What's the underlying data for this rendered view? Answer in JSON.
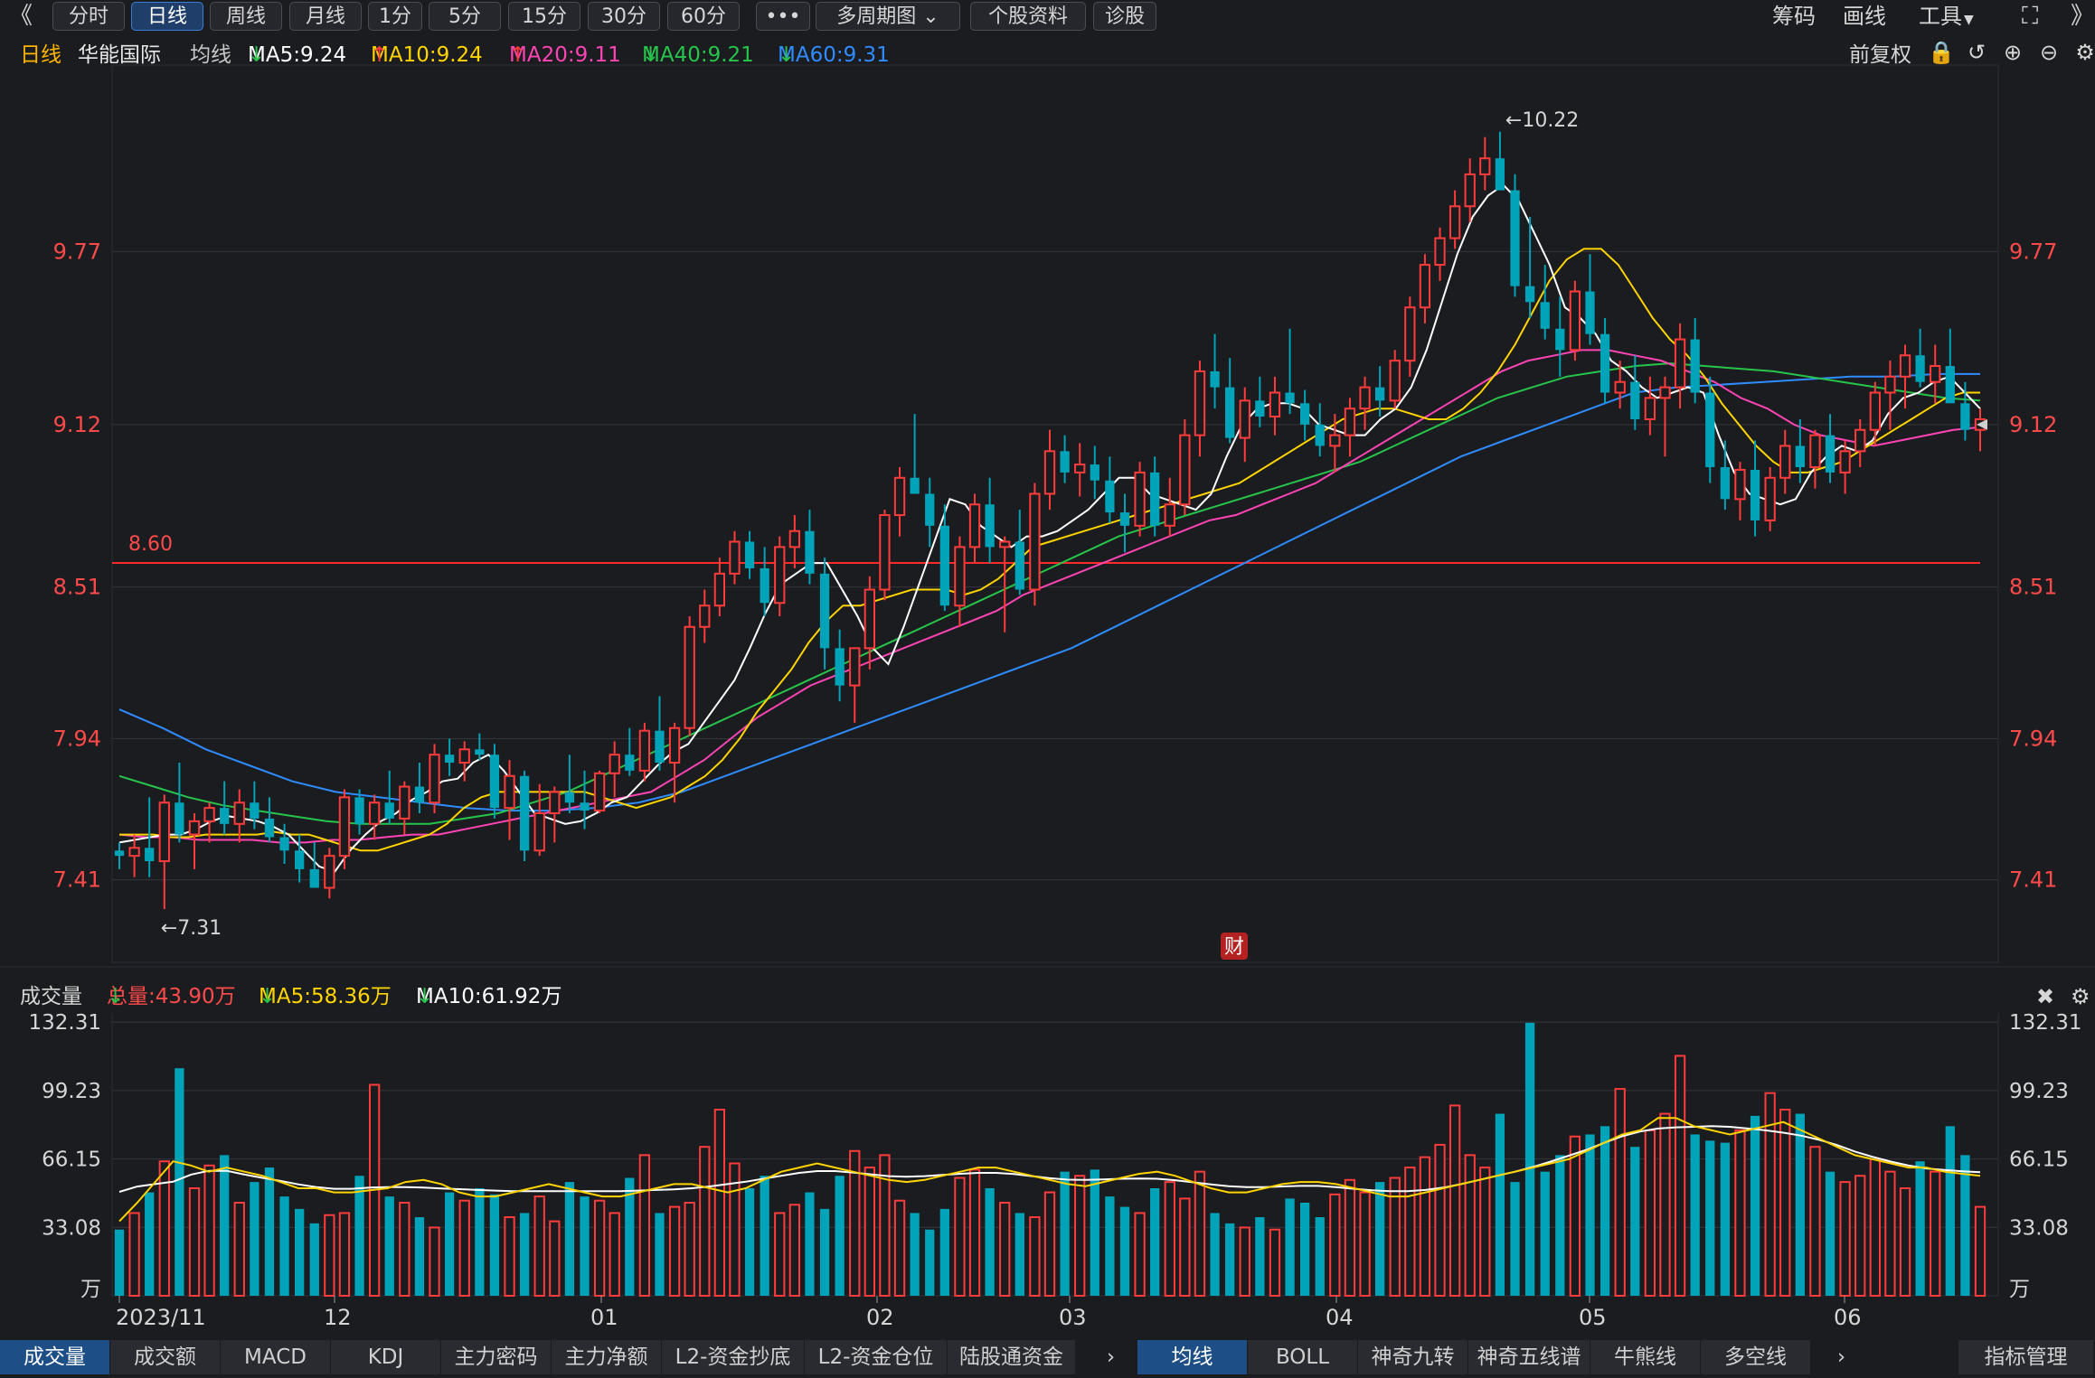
{
  "toolbar": {
    "back_icon": "double-chevron-left-icon",
    "tabs": [
      {
        "label": "分时",
        "active": false
      },
      {
        "label": "日线",
        "active": true
      },
      {
        "label": "周线",
        "active": false
      },
      {
        "label": "月线",
        "active": false
      },
      {
        "label": "1分",
        "active": false
      },
      {
        "label": "5分",
        "active": false
      },
      {
        "label": "15分",
        "active": false
      },
      {
        "label": "30分",
        "active": false
      },
      {
        "label": "60分",
        "active": false
      },
      {
        "label": "•••",
        "active": false
      },
      {
        "label": "多周期图",
        "active": false
      },
      {
        "label": "个股资料",
        "active": false
      },
      {
        "label": "诊股",
        "active": false
      }
    ],
    "right": [
      "筹码",
      "画线",
      "工具"
    ]
  },
  "legend": {
    "period": "日线",
    "stock": "华能国际",
    "ma_label": "均线",
    "mas": [
      {
        "text": "MA5:9.24",
        "arrow": "↓",
        "color": "#ffffff",
        "arrow_color": "#27c44b"
      },
      {
        "text": "MA10:9.24",
        "arrow": "↑",
        "color": "#ffd400",
        "arrow_color": "#ff3b3b"
      },
      {
        "text": "MA20:9.11",
        "arrow": "↑",
        "color": "#ff44b4",
        "arrow_color": "#ff3b3b"
      },
      {
        "text": "MA40:9.21",
        "arrow": "↓",
        "color": "#27c44b",
        "arrow_color": "#27c44b"
      },
      {
        "text": "MA60:9.31",
        "arrow": "↓",
        "color": "#2f8cff",
        "arrow_color": "#27c44b"
      }
    ],
    "fq": "前复权"
  },
  "volume_legend": {
    "title": "成交量",
    "total": "总量:43.90万",
    "ma5": "MA5:58.36万",
    "ma10": "MA10:61.92万"
  },
  "bottom_tabs_left": [
    "成交量",
    "成交额",
    "MACD",
    "KDJ",
    "主力密码",
    "主力净额",
    "L2-资金抄底",
    "L2-资金仓位",
    "陆股通资金"
  ],
  "bottom_tabs_right": [
    "均线",
    "BOLL",
    "神奇九转",
    "神奇五线谱",
    "牛熊线",
    "多空线"
  ],
  "bottom_right": "指标管理",
  "colors": {
    "up": "#ff3b3b",
    "down": "#00a3b8",
    "bg": "#1b1c20",
    "grid": "#34363c"
  },
  "chart_data": {
    "type": "candlestick",
    "price_ticks": [
      "9.77",
      "9.12",
      "8.51",
      "7.94",
      "7.41"
    ],
    "price_ylim": [
      7.1,
      10.45
    ],
    "volume_ticks": [
      "132.31",
      "99.23",
      "66.15",
      "33.08",
      "万"
    ],
    "volume_unit": "万",
    "volume_ylim": [
      0,
      135
    ],
    "x_labels": [
      "2023/11",
      "12",
      "01",
      "02",
      "03",
      "04",
      "05",
      "06"
    ],
    "hline": {
      "label": "8.60",
      "value": 8.6
    },
    "max_annotation": "←10.22",
    "min_annotation": "←7.31",
    "finance_badge": "财",
    "ohlc": [
      [
        7.52,
        7.55,
        7.45,
        7.5
      ],
      [
        7.5,
        7.58,
        7.42,
        7.53
      ],
      [
        7.53,
        7.72,
        7.42,
        7.48
      ],
      [
        7.48,
        7.73,
        7.3,
        7.7
      ],
      [
        7.7,
        7.85,
        7.55,
        7.58
      ],
      [
        7.58,
        7.66,
        7.45,
        7.63
      ],
      [
        7.63,
        7.7,
        7.55,
        7.68
      ],
      [
        7.68,
        7.78,
        7.58,
        7.62
      ],
      [
        7.62,
        7.75,
        7.55,
        7.7
      ],
      [
        7.7,
        7.78,
        7.6,
        7.64
      ],
      [
        7.64,
        7.72,
        7.55,
        7.57
      ],
      [
        7.57,
        7.62,
        7.47,
        7.52
      ],
      [
        7.52,
        7.58,
        7.4,
        7.45
      ],
      [
        7.45,
        7.55,
        7.38,
        7.38
      ],
      [
        7.38,
        7.53,
        7.34,
        7.5
      ],
      [
        7.5,
        7.75,
        7.45,
        7.72
      ],
      [
        7.72,
        7.75,
        7.58,
        7.62
      ],
      [
        7.62,
        7.73,
        7.56,
        7.7
      ],
      [
        7.7,
        7.82,
        7.62,
        7.64
      ],
      [
        7.64,
        7.78,
        7.58,
        7.76
      ],
      [
        7.76,
        7.85,
        7.66,
        7.7
      ],
      [
        7.7,
        7.92,
        7.66,
        7.88
      ],
      [
        7.88,
        7.94,
        7.8,
        7.85
      ],
      [
        7.85,
        7.93,
        7.78,
        7.9
      ],
      [
        7.9,
        7.96,
        7.86,
        7.88
      ],
      [
        7.88,
        7.92,
        7.64,
        7.68
      ],
      [
        7.68,
        7.86,
        7.56,
        7.8
      ],
      [
        7.8,
        7.82,
        7.48,
        7.52
      ],
      [
        7.52,
        7.77,
        7.5,
        7.66
      ],
      [
        7.66,
        7.76,
        7.55,
        7.74
      ],
      [
        7.74,
        7.88,
        7.66,
        7.7
      ],
      [
        7.7,
        7.82,
        7.6,
        7.67
      ],
      [
        7.67,
        7.82,
        7.66,
        7.81
      ],
      [
        7.81,
        7.93,
        7.72,
        7.88
      ],
      [
        7.88,
        7.98,
        7.8,
        7.82
      ],
      [
        7.82,
        8.0,
        7.78,
        7.97
      ],
      [
        7.97,
        8.1,
        7.82,
        7.85
      ],
      [
        7.85,
        8.0,
        7.7,
        7.98
      ],
      [
        7.98,
        8.4,
        7.95,
        8.36
      ],
      [
        8.36,
        8.5,
        8.3,
        8.44
      ],
      [
        8.44,
        8.62,
        8.4,
        8.56
      ],
      [
        8.56,
        8.72,
        8.52,
        8.68
      ],
      [
        8.68,
        8.72,
        8.54,
        8.58
      ],
      [
        8.58,
        8.66,
        8.4,
        8.45
      ],
      [
        8.45,
        8.7,
        8.4,
        8.66
      ],
      [
        8.66,
        8.78,
        8.58,
        8.72
      ],
      [
        8.72,
        8.8,
        8.52,
        8.56
      ],
      [
        8.56,
        8.62,
        8.2,
        8.28
      ],
      [
        8.28,
        8.35,
        8.08,
        8.14
      ],
      [
        8.14,
        8.28,
        8.0,
        8.28
      ],
      [
        8.28,
        8.55,
        8.2,
        8.5
      ],
      [
        8.5,
        8.8,
        8.46,
        8.78
      ],
      [
        8.78,
        8.96,
        8.7,
        8.92
      ],
      [
        8.92,
        9.16,
        8.86,
        8.86
      ],
      [
        8.86,
        8.92,
        8.66,
        8.74
      ],
      [
        8.74,
        8.82,
        8.42,
        8.44
      ],
      [
        8.44,
        8.7,
        8.36,
        8.66
      ],
      [
        8.66,
        8.86,
        8.6,
        8.82
      ],
      [
        8.82,
        8.92,
        8.6,
        8.66
      ],
      [
        8.66,
        8.7,
        8.34,
        8.68
      ],
      [
        8.68,
        8.8,
        8.48,
        8.5
      ],
      [
        8.5,
        8.9,
        8.44,
        8.86
      ],
      [
        8.86,
        9.1,
        8.8,
        9.02
      ],
      [
        9.02,
        9.08,
        8.9,
        8.94
      ],
      [
        8.94,
        9.05,
        8.85,
        8.97
      ],
      [
        8.97,
        9.04,
        8.84,
        8.91
      ],
      [
        8.91,
        9.0,
        8.75,
        8.79
      ],
      [
        8.79,
        8.86,
        8.64,
        8.74
      ],
      [
        8.74,
        8.98,
        8.7,
        8.94
      ],
      [
        8.94,
        9.0,
        8.7,
        8.74
      ],
      [
        8.74,
        8.92,
        8.7,
        8.82
      ],
      [
        8.82,
        9.14,
        8.78,
        9.08
      ],
      [
        9.08,
        9.36,
        9.0,
        9.32
      ],
      [
        9.32,
        9.46,
        9.18,
        9.26
      ],
      [
        9.26,
        9.37,
        9.05,
        9.07
      ],
      [
        9.07,
        9.26,
        8.98,
        9.21
      ],
      [
        9.21,
        9.3,
        9.11,
        9.15
      ],
      [
        9.15,
        9.3,
        9.08,
        9.24
      ],
      [
        9.24,
        9.48,
        9.16,
        9.2
      ],
      [
        9.2,
        9.25,
        9.06,
        9.12
      ],
      [
        9.12,
        9.2,
        9.0,
        9.04
      ],
      [
        9.04,
        9.16,
        8.94,
        9.08
      ],
      [
        9.08,
        9.22,
        9.0,
        9.18
      ],
      [
        9.18,
        9.3,
        9.1,
        9.26
      ],
      [
        9.26,
        9.34,
        9.15,
        9.21
      ],
      [
        9.21,
        9.4,
        9.18,
        9.36
      ],
      [
        9.36,
        9.6,
        9.3,
        9.56
      ],
      [
        9.56,
        9.76,
        9.5,
        9.72
      ],
      [
        9.72,
        9.86,
        9.66,
        9.82
      ],
      [
        9.82,
        10.0,
        9.78,
        9.94
      ],
      [
        9.94,
        10.12,
        9.88,
        10.06
      ],
      [
        10.06,
        10.2,
        10.0,
        10.12
      ],
      [
        10.12,
        10.22,
        10.04,
        10.0
      ],
      [
        10.0,
        10.06,
        9.6,
        9.64
      ],
      [
        9.64,
        9.9,
        9.52,
        9.58
      ],
      [
        9.58,
        9.72,
        9.44,
        9.48
      ],
      [
        9.48,
        9.6,
        9.3,
        9.4
      ],
      [
        9.4,
        9.66,
        9.36,
        9.62
      ],
      [
        9.62,
        9.76,
        9.42,
        9.46
      ],
      [
        9.46,
        9.52,
        9.2,
        9.24
      ],
      [
        9.24,
        9.36,
        9.18,
        9.28
      ],
      [
        9.28,
        9.38,
        9.1,
        9.14
      ],
      [
        9.14,
        9.3,
        9.08,
        9.22
      ],
      [
        9.22,
        9.3,
        9.0,
        9.26
      ],
      [
        9.26,
        9.5,
        9.18,
        9.44
      ],
      [
        9.44,
        9.52,
        9.2,
        9.24
      ],
      [
        9.24,
        9.3,
        8.9,
        8.96
      ],
      [
        8.96,
        9.06,
        8.8,
        8.84
      ],
      [
        8.84,
        8.98,
        8.76,
        8.95
      ],
      [
        8.95,
        9.06,
        8.7,
        8.76
      ],
      [
        8.76,
        8.96,
        8.72,
        8.92
      ],
      [
        8.92,
        9.1,
        8.86,
        9.04
      ],
      [
        9.04,
        9.14,
        8.9,
        8.96
      ],
      [
        8.96,
        9.1,
        8.88,
        9.08
      ],
      [
        9.08,
        9.16,
        8.9,
        8.94
      ],
      [
        8.94,
        9.06,
        8.86,
        9.02
      ],
      [
        9.02,
        9.14,
        8.96,
        9.1
      ],
      [
        9.1,
        9.28,
        9.04,
        9.24
      ],
      [
        9.24,
        9.36,
        9.1,
        9.3
      ],
      [
        9.3,
        9.42,
        9.18,
        9.38
      ],
      [
        9.38,
        9.48,
        9.26,
        9.28
      ],
      [
        9.28,
        9.42,
        9.2,
        9.34
      ],
      [
        9.34,
        9.48,
        9.26,
        9.2
      ],
      [
        9.2,
        9.28,
        9.06,
        9.1
      ],
      [
        9.1,
        9.18,
        9.02,
        9.14
      ]
    ],
    "ma5": [
      7.55,
      7.56,
      7.57,
      7.58,
      7.58,
      7.6,
      7.63,
      7.65,
      7.64,
      7.63,
      7.61,
      7.58,
      7.52,
      7.46,
      7.44,
      7.52,
      7.58,
      7.63,
      7.66,
      7.71,
      7.74,
      7.78,
      7.79,
      7.85,
      7.88,
      7.82,
      7.74,
      7.66,
      7.64,
      7.62,
      7.63,
      7.66,
      7.7,
      7.72,
      7.78,
      7.84,
      7.89,
      7.92,
      8.0,
      8.08,
      8.16,
      8.28,
      8.41,
      8.52,
      8.56,
      8.6,
      8.6,
      8.5,
      8.4,
      8.28,
      8.22,
      8.36,
      8.52,
      8.68,
      8.84,
      8.82,
      8.74,
      8.7,
      8.66,
      8.7,
      8.7,
      8.72,
      8.76,
      8.8,
      8.86,
      8.92,
      8.92,
      8.86,
      8.84,
      8.82,
      8.8,
      8.86,
      9.0,
      9.12,
      9.18,
      9.2,
      9.2,
      9.18,
      9.12,
      9.1,
      9.08,
      9.08,
      9.14,
      9.18,
      9.26,
      9.4,
      9.58,
      9.76,
      9.9,
      9.98,
      10.02,
      9.96,
      9.84,
      9.72,
      9.56,
      9.52,
      9.46,
      9.36,
      9.32,
      9.26,
      9.22,
      9.24,
      9.26,
      9.24,
      9.08,
      8.94,
      8.86,
      8.84,
      8.82,
      8.84,
      8.94,
      9.0,
      9.04,
      9.02,
      9.06,
      9.16,
      9.22,
      9.24,
      9.28,
      9.3,
      9.24,
      9.18
    ],
    "ma10": [
      7.58,
      7.58,
      7.58,
      7.57,
      7.57,
      7.58,
      7.58,
      7.58,
      7.58,
      7.59,
      7.58,
      7.58,
      7.56,
      7.54,
      7.52,
      7.52,
      7.54,
      7.56,
      7.58,
      7.62,
      7.68,
      7.72,
      7.74,
      7.74,
      7.74,
      7.74,
      7.74,
      7.74,
      7.72,
      7.7,
      7.68,
      7.7,
      7.72,
      7.76,
      7.8,
      7.86,
      7.94,
      8.04,
      8.12,
      8.2,
      8.3,
      8.38,
      8.44,
      8.44,
      8.46,
      8.48,
      8.5,
      8.5,
      8.5,
      8.48,
      8.5,
      8.54,
      8.6,
      8.66,
      8.68,
      8.7,
      8.72,
      8.74,
      8.76,
      8.78,
      8.8,
      8.82,
      8.84,
      8.86,
      8.88,
      8.9,
      8.94,
      8.98,
      9.02,
      9.06,
      9.1,
      9.14,
      9.16,
      9.18,
      9.18,
      9.16,
      9.14,
      9.14,
      9.18,
      9.24,
      9.32,
      9.42,
      9.54,
      9.66,
      9.74,
      9.78,
      9.78,
      9.72,
      9.62,
      9.52,
      9.44,
      9.38,
      9.3,
      9.2,
      9.12,
      9.04,
      8.98,
      8.94,
      8.94,
      8.96,
      8.98,
      9.02,
      9.06,
      9.1,
      9.14,
      9.18,
      9.22,
      9.24,
      9.24
    ],
    "ma20": [
      7.58,
      7.57,
      7.57,
      7.56,
      7.56,
      7.56,
      7.55,
      7.55,
      7.56,
      7.56,
      7.57,
      7.58,
      7.58,
      7.6,
      7.62,
      7.64,
      7.66,
      7.68,
      7.7,
      7.72,
      7.74,
      7.8,
      7.86,
      7.94,
      8.02,
      8.08,
      8.14,
      8.18,
      8.22,
      8.26,
      8.3,
      8.34,
      8.38,
      8.42,
      8.48,
      8.52,
      8.56,
      8.6,
      8.64,
      8.68,
      8.72,
      8.76,
      8.78,
      8.82,
      8.86,
      8.9,
      8.96,
      9.02,
      9.08,
      9.14,
      9.2,
      9.26,
      9.32,
      9.36,
      9.38,
      9.4,
      9.4,
      9.38,
      9.36,
      9.32,
      9.28,
      9.22,
      9.18,
      9.12,
      9.08,
      9.06,
      9.04,
      9.06,
      9.08,
      9.1,
      9.11
    ],
    "ma40": [
      7.8,
      7.76,
      7.72,
      7.69,
      7.67,
      7.65,
      7.63,
      7.62,
      7.62,
      7.62,
      7.64,
      7.66,
      7.7,
      7.74,
      7.8,
      7.86,
      7.92,
      7.98,
      8.04,
      8.1,
      8.16,
      8.22,
      8.28,
      8.34,
      8.4,
      8.46,
      8.52,
      8.58,
      8.64,
      8.7,
      8.74,
      8.78,
      8.82,
      8.86,
      8.9,
      8.94,
      8.98,
      9.04,
      9.1,
      9.16,
      9.22,
      9.26,
      9.3,
      9.32,
      9.34,
      9.35,
      9.34,
      9.33,
      9.32,
      9.3,
      9.28,
      9.26,
      9.24,
      9.22,
      9.21
    ],
    "ma60": [
      8.05,
      7.98,
      7.9,
      7.84,
      7.78,
      7.74,
      7.72,
      7.7,
      7.68,
      7.67,
      7.67,
      7.68,
      7.7,
      7.74,
      7.8,
      7.86,
      7.92,
      7.98,
      8.04,
      8.1,
      8.16,
      8.22,
      8.28,
      8.36,
      8.44,
      8.52,
      8.6,
      8.68,
      8.76,
      8.84,
      8.92,
      9.0,
      9.06,
      9.12,
      9.18,
      9.24,
      9.26,
      9.27,
      9.28,
      9.29,
      9.3,
      9.3,
      9.31,
      9.31
    ],
    "volume": [
      32,
      40,
      50,
      65,
      110,
      52,
      63,
      68,
      45,
      55,
      62,
      48,
      42,
      35,
      39,
      40,
      58,
      102,
      48,
      45,
      38,
      33,
      50,
      46,
      52,
      49,
      38,
      40,
      48,
      36,
      55,
      48,
      46,
      40,
      57,
      68,
      40,
      43,
      45,
      72,
      90,
      64,
      52,
      58,
      40,
      44,
      50,
      42,
      58,
      70,
      62,
      68,
      46,
      40,
      32,
      42,
      57,
      61,
      52,
      45,
      40,
      38,
      50,
      60,
      58,
      61,
      48,
      43,
      40,
      52,
      55,
      47,
      60,
      40,
      35,
      33,
      38,
      32,
      47,
      45,
      38,
      49,
      56,
      50,
      55,
      57,
      62,
      67,
      73,
      92,
      68,
      62,
      88,
      55,
      132,
      60,
      68,
      77,
      78,
      82,
      100,
      72,
      80,
      88,
      116,
      78,
      75,
      74,
      80,
      87,
      98,
      90,
      88,
      72,
      60,
      55,
      58,
      66,
      60,
      52,
      65,
      60,
      82,
      68,
      43
    ],
    "vol_ma5": [
      36,
      45,
      55,
      65,
      63,
      60,
      62,
      60,
      58,
      55,
      52,
      52,
      50,
      50,
      51,
      52,
      55,
      56,
      54,
      50,
      48,
      48,
      50,
      52,
      54,
      52,
      50,
      48,
      48,
      50,
      52,
      54,
      54,
      52,
      50,
      52,
      56,
      60,
      62,
      64,
      62,
      60,
      58,
      56,
      55,
      56,
      58,
      60,
      62,
      62,
      60,
      58,
      56,
      54,
      53,
      55,
      57,
      59,
      60,
      58,
      55,
      52,
      50,
      50,
      52,
      54,
      55,
      55,
      54,
      52,
      50,
      48,
      48,
      50,
      52,
      54,
      56,
      58,
      60,
      62,
      64,
      66,
      70,
      74,
      78,
      80,
      86,
      86,
      82,
      80,
      78,
      80,
      82,
      84,
      80,
      76,
      72,
      68,
      66,
      64,
      62,
      62,
      60,
      59,
      58
    ]
  }
}
